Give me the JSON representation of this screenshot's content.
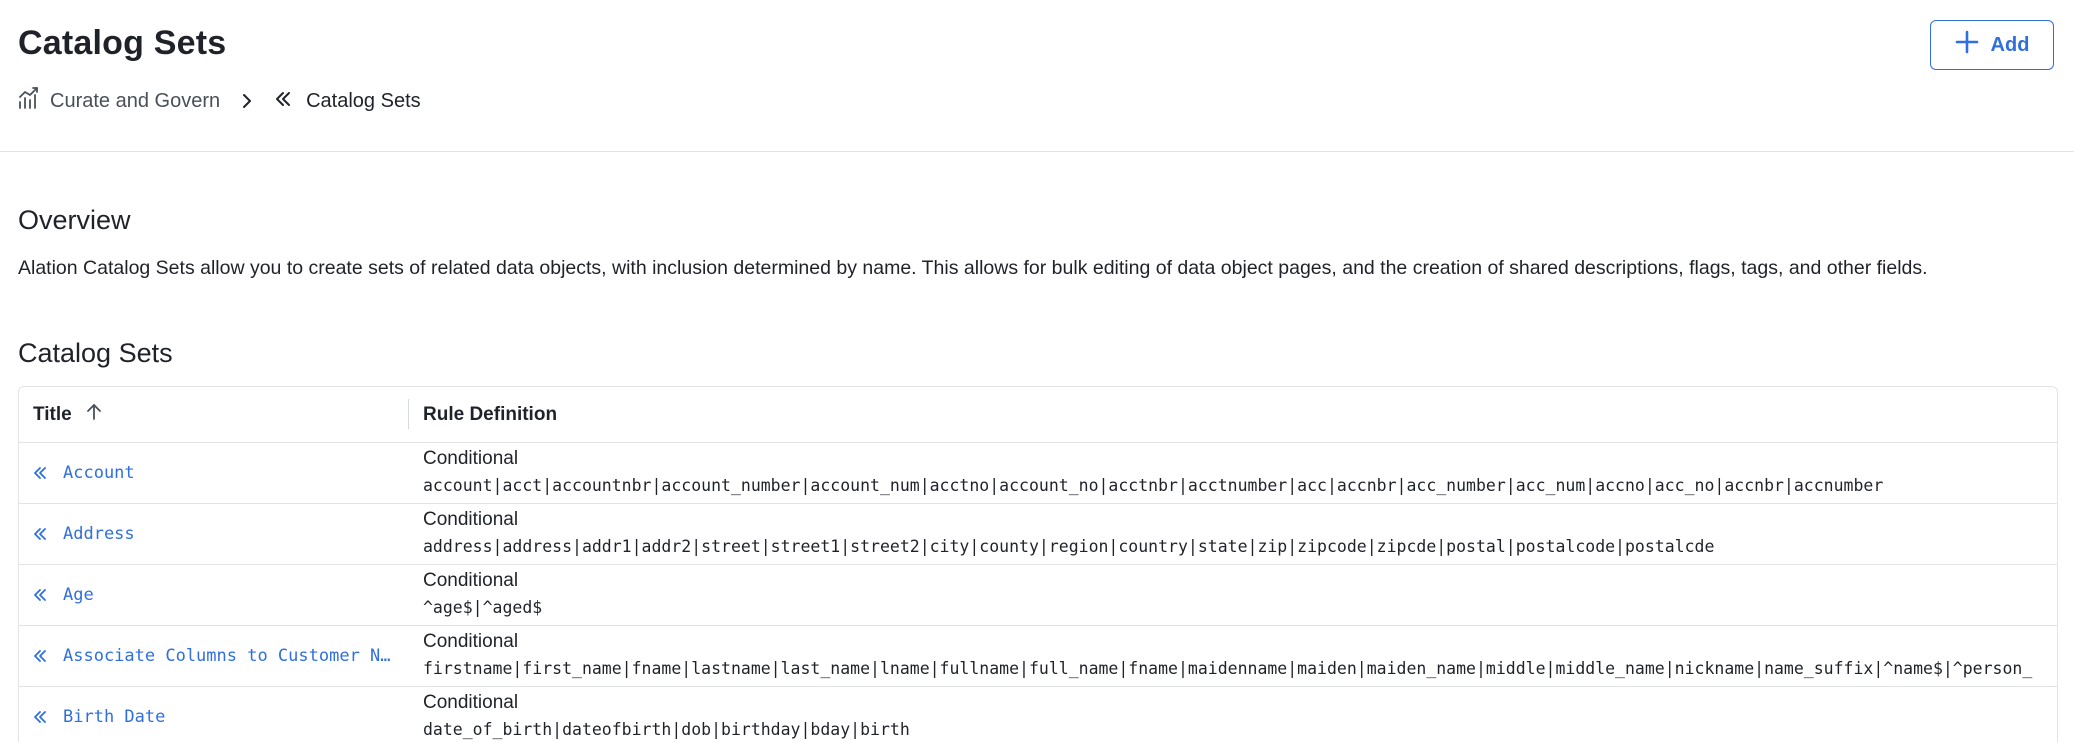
{
  "header": {
    "title": "Catalog Sets",
    "add_label": "Add",
    "breadcrumb": [
      {
        "label": "Curate and Govern",
        "icon": "chart-growth-icon"
      },
      {
        "label": "Catalog Sets",
        "icon": "catalog-set-icon"
      }
    ]
  },
  "overview": {
    "heading": "Overview",
    "text": "Alation Catalog Sets allow you to create sets of related data objects, with inclusion determined by name. This allows for bulk editing of data object pages, and the creation of shared descriptions, flags, tags, and other fields."
  },
  "catalog_sets": {
    "heading": "Catalog Sets",
    "columns": [
      "Title",
      "Rule Definition"
    ],
    "sort": {
      "column": "Title",
      "direction": "ascending"
    },
    "rows": [
      {
        "title": "Account",
        "rule_type": "Conditional",
        "rule": "account|acct|accountnbr|account_number|account_num|acctno|account_no|acctnbr|acctnumber|acc|accnbr|acc_number|acc_num|accno|acc_no|accnbr|accnumber"
      },
      {
        "title": "Address",
        "rule_type": "Conditional",
        "rule": "address|address|addr1|addr2|street|street1|street2|city|county|region|country|state|zip|zipcode|zipcde|postal|postalcode|postalcde"
      },
      {
        "title": "Age",
        "rule_type": "Conditional",
        "rule": "^age$|^aged$"
      },
      {
        "title": "Associate Columns to Customer N…",
        "rule_type": "Conditional",
        "rule": "firstname|first_name|fname|lastname|last_name|lname|fullname|full_name|fname|maidenname|maiden|maiden_name|middle|middle_name|nickname|name_suffix|^name$|^person_"
      },
      {
        "title": "Birth Date",
        "rule_type": "Conditional",
        "rule": "date_of_birth|dateofbirth|dob|birthday|bday|birth"
      }
    ]
  },
  "colors": {
    "accent": "#2f6fdf",
    "text": "#1f2329",
    "border": "#e2e4e8"
  }
}
